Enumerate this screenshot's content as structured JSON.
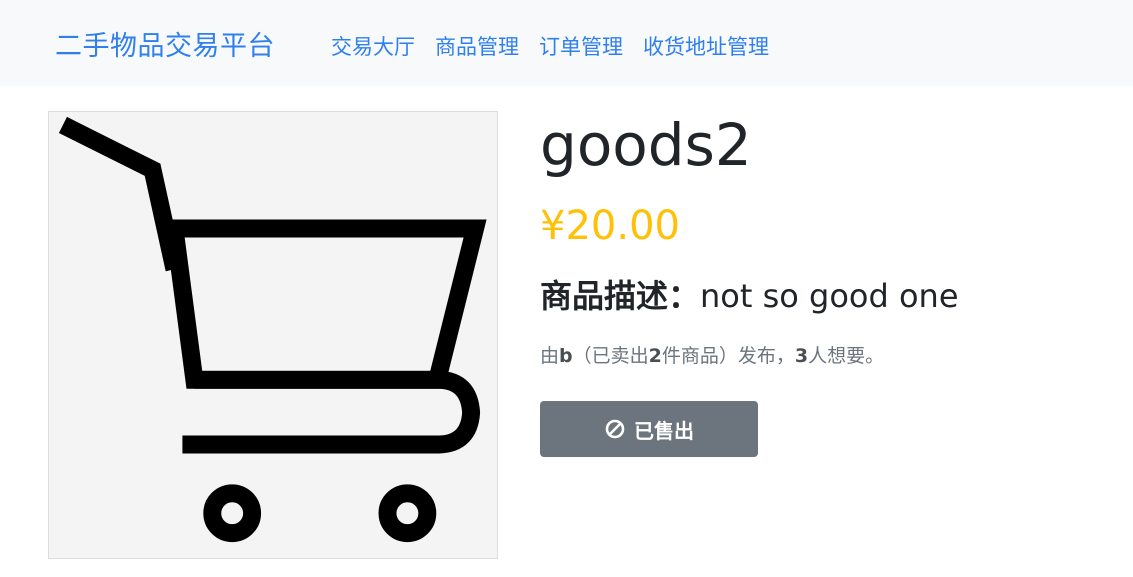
{
  "navbar": {
    "brand": "二手物品交易平台",
    "links": [
      {
        "label": "交易大厅"
      },
      {
        "label": "商品管理"
      },
      {
        "label": "订单管理"
      },
      {
        "label": "收货地址管理"
      }
    ]
  },
  "product": {
    "image_icon": "shopping-cart-icon",
    "title": "goods2",
    "price": "¥20.00",
    "description_label": "商品描述：",
    "description": "not so good one",
    "meta": {
      "prefix": "由",
      "seller": "b",
      "mid1": "（已卖出",
      "sold_count": "2",
      "mid2": "件商品）发布，",
      "want_count": "3",
      "suffix": "人想要。"
    },
    "status_button": {
      "icon": "ban-icon",
      "label": "已售出"
    }
  },
  "colors": {
    "brand": "#2f80ed",
    "price": "#ffc107",
    "button": "#6c757d",
    "navbar_bg": "#f8f9fa"
  }
}
